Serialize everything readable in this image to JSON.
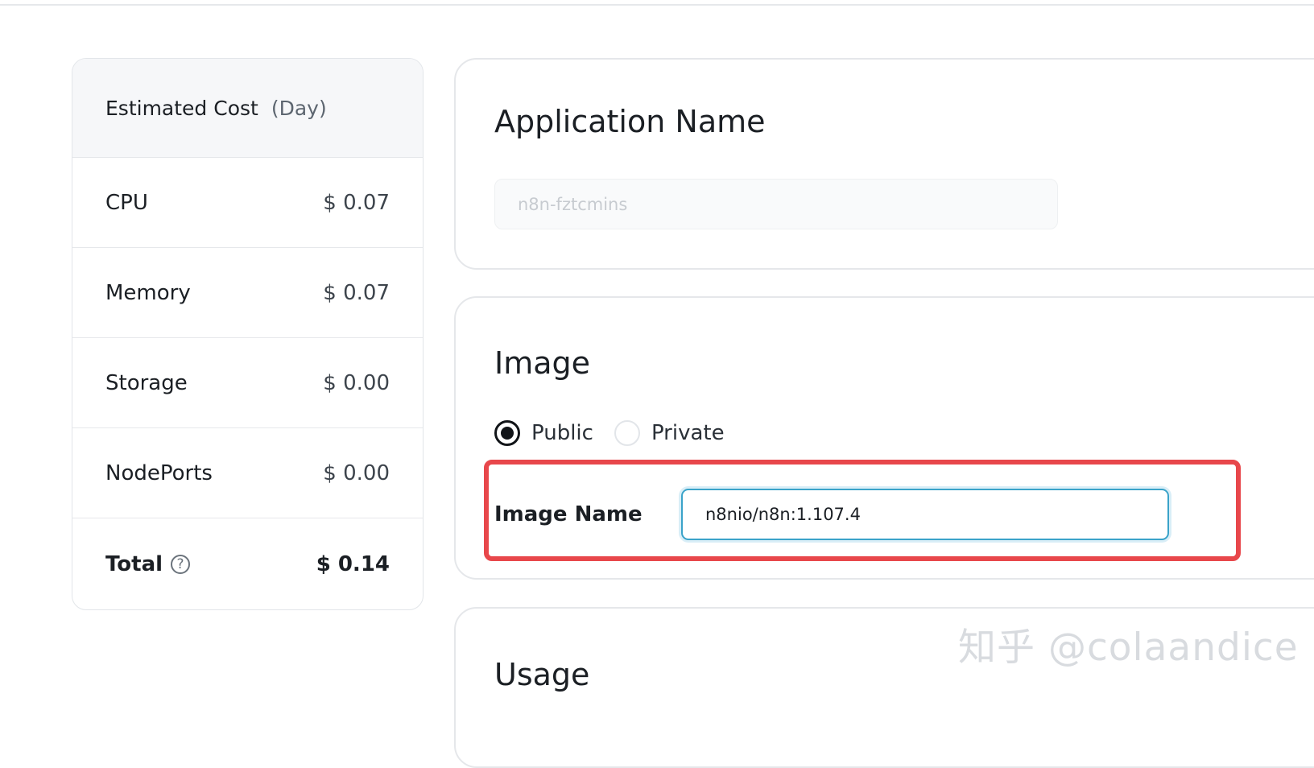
{
  "cost": {
    "title": "Estimated Cost",
    "period": "(Day)",
    "rows": [
      {
        "label": "CPU",
        "value": "$ 0.07"
      },
      {
        "label": "Memory",
        "value": "$ 0.07"
      },
      {
        "label": "Storage",
        "value": "$ 0.00"
      },
      {
        "label": "NodePorts",
        "value": "$ 0.00"
      }
    ],
    "total_label": "Total",
    "total_value": "$ 0.14",
    "help_glyph": "?"
  },
  "application": {
    "title": "Application Name",
    "name_value": "n8n-fztcmins"
  },
  "image": {
    "title": "Image",
    "radio_public": "Public",
    "radio_private": "Private",
    "selected": "Public",
    "image_name_label": "Image Name",
    "image_name_value": "n8nio/n8n:1.107.4",
    "highlight_color": "#e8474b"
  },
  "usage": {
    "title": "Usage"
  },
  "watermark": {
    "text": "知乎 @colaandice"
  },
  "icons": {
    "help": "help-circle-icon"
  }
}
